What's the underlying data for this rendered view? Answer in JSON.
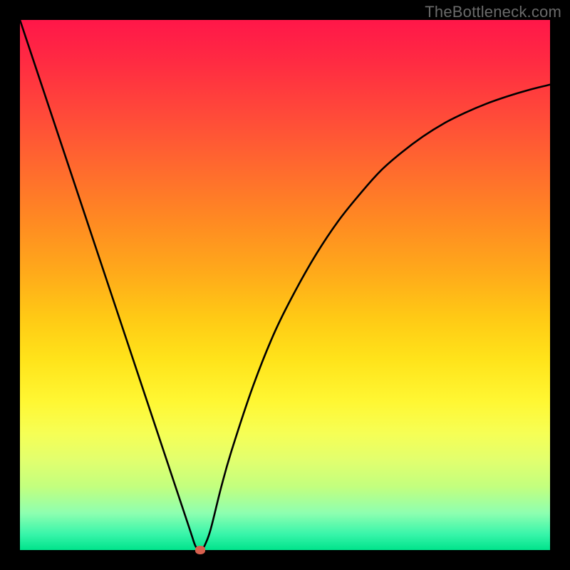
{
  "watermark": "TheBottleneck.com",
  "chart_data": {
    "type": "line",
    "title": "",
    "xlabel": "",
    "ylabel": "",
    "xlim": [
      0,
      100
    ],
    "ylim": [
      0,
      100
    ],
    "grid": false,
    "series": [
      {
        "name": "bottleneck-curve",
        "x": [
          0,
          4,
          8,
          12,
          16,
          20,
          24,
          28,
          32,
          33,
          33.5,
          34,
          34.5,
          35,
          36,
          38,
          40,
          44,
          48,
          52,
          56,
          60,
          64,
          68,
          72,
          76,
          80,
          84,
          88,
          92,
          96,
          100
        ],
        "values": [
          100,
          88,
          76,
          64,
          52,
          40,
          28,
          16,
          4,
          1,
          0.3,
          0,
          0.3,
          1.2,
          4,
          12,
          19,
          31,
          41,
          49,
          56,
          62,
          67,
          71.5,
          75,
          78,
          80.5,
          82.5,
          84.2,
          85.6,
          86.8,
          87.8
        ]
      }
    ],
    "annotations": [
      {
        "name": "minimum-marker",
        "x": 34,
        "y": 0
      }
    ],
    "background": {
      "type": "vertical-gradient",
      "top_color": "#ff1749",
      "mid_color": "#ffe31a",
      "bottom_color": "#00e38b"
    }
  }
}
